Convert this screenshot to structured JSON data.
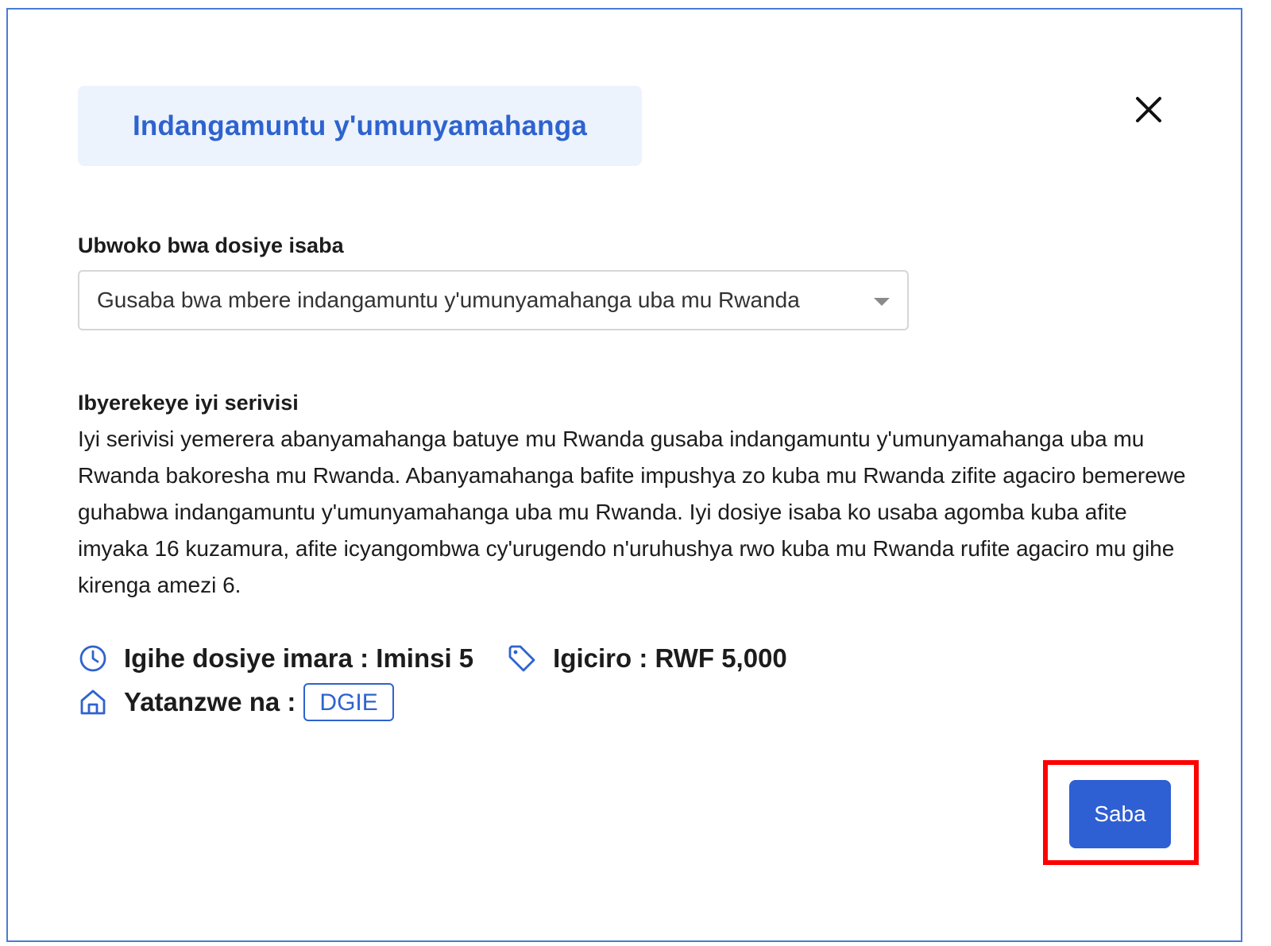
{
  "modal": {
    "title": "Indangamuntu y'umunyamahanga",
    "close_icon": "close-icon"
  },
  "application_type": {
    "label": "Ubwoko bwa dosiye isaba",
    "selected_value": "Gusaba bwa mbere indangamuntu y'umunyamahanga uba mu Rwanda"
  },
  "description": {
    "heading": "Ibyerekeye iyi serivisi",
    "body": "Iyi serivisi yemerera abanyamahanga batuye mu Rwanda gusaba indangamuntu y'umunyamahanga uba mu Rwanda bakoresha mu Rwanda. Abanyamahanga bafite impushya zo kuba mu Rwanda zifite agaciro bemerewe guhabwa indangamuntu y'umunyamahanga uba mu Rwanda. Iyi dosiye isaba ko usaba agomba kuba afite imyaka 16 kuzamura, afite icyangombwa cy'urugendo n'uruhushya rwo kuba mu Rwanda rufite agaciro mu gihe kirenga amezi 6."
  },
  "meta": {
    "processing_time": "Igihe dosiye imara : Iminsi 5",
    "price": "Igiciro : RWF 5,000",
    "provider_label": "Yatanzwe na :",
    "provider_value": "DGIE",
    "icons": {
      "time": "clock-icon",
      "price": "price-tag-icon",
      "provider": "home-icon"
    }
  },
  "actions": {
    "submit_label": "Saba"
  },
  "colors": {
    "accent": "#2e63cf",
    "title_bg": "#edf3fd",
    "highlight": "#ff0000",
    "modal_border": "#4a7bd6"
  }
}
